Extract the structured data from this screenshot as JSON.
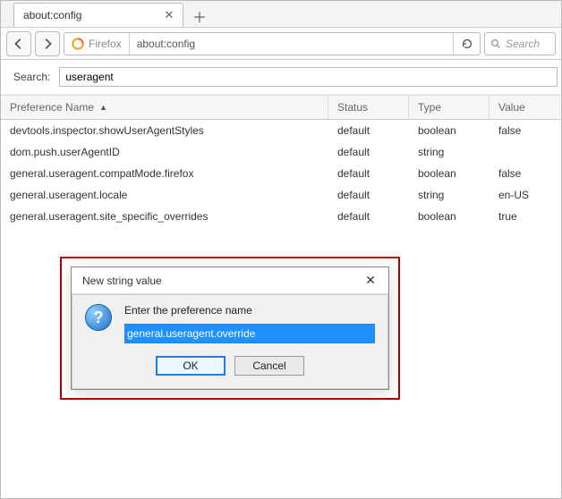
{
  "tab": {
    "title": "about:config"
  },
  "nav": {
    "identity": "Firefox",
    "url": "about:config",
    "search_placeholder": "Search"
  },
  "search": {
    "label": "Search:",
    "value": "useragent"
  },
  "columns": {
    "name": "Preference Name",
    "status": "Status",
    "type": "Type",
    "value": "Value"
  },
  "rows": [
    {
      "name": "devtools.inspector.showUserAgentStyles",
      "status": "default",
      "type": "boolean",
      "value": "false"
    },
    {
      "name": "dom.push.userAgentID",
      "status": "default",
      "type": "string",
      "value": ""
    },
    {
      "name": "general.useragent.compatMode.firefox",
      "status": "default",
      "type": "boolean",
      "value": "false"
    },
    {
      "name": "general.useragent.locale",
      "status": "default",
      "type": "string",
      "value": "en-US"
    },
    {
      "name": "general.useragent.site_specific_overrides",
      "status": "default",
      "type": "boolean",
      "value": "true"
    }
  ],
  "dialog": {
    "title": "New string value",
    "prompt": "Enter the preference name",
    "value": "general.useragent.override",
    "ok": "OK",
    "cancel": "Cancel"
  }
}
